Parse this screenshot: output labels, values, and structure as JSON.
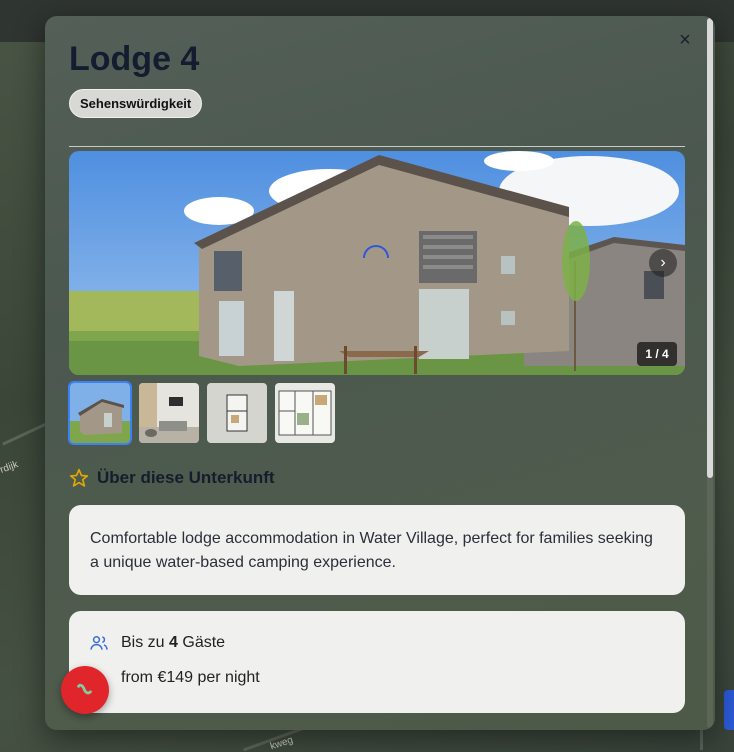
{
  "map": {
    "labels": [
      "rdijk",
      "kweg"
    ]
  },
  "modal": {
    "title": "Lodge 4",
    "badge": "Sehenswürdigkeit",
    "close_symbol": "×"
  },
  "gallery": {
    "counter": "1 / 4",
    "next_symbol": "›",
    "thumbnails": [
      "exterior",
      "living-room",
      "floor-plan-small",
      "floor-plan-detailed"
    ],
    "active_index": 0
  },
  "about": {
    "icon": "star-icon",
    "title": "Über diese Unterkunft",
    "description": "Comfortable lodge accommodation in Water Village, perfect for families seeking a unique water-based camping experience."
  },
  "details": {
    "guests_prefix": "Bis zu ",
    "guests_count": "4",
    "guests_suffix": " Gäste",
    "price": "from €149 per night"
  },
  "colors": {
    "accent": "#3b82f6",
    "fab": "#e0262b",
    "title": "#141d30",
    "star": "#e0a800"
  }
}
